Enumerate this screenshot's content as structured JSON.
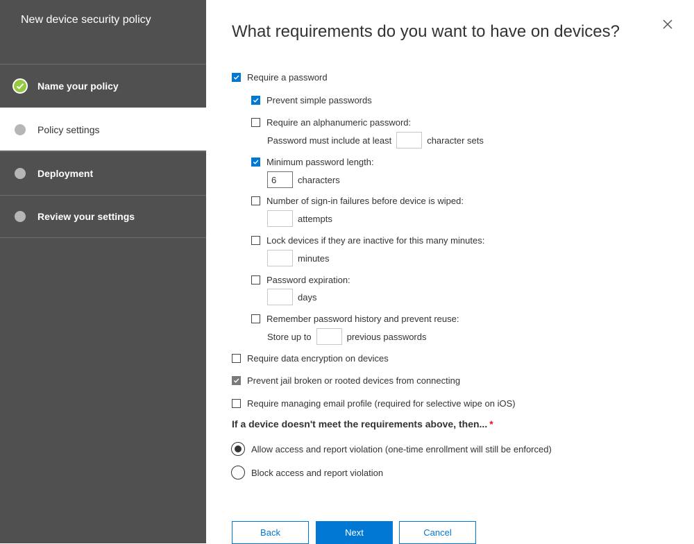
{
  "sidebar": {
    "title": "New device security policy",
    "steps": [
      {
        "label": "Name your policy",
        "state": "completed"
      },
      {
        "label": "Policy settings",
        "state": "active"
      },
      {
        "label": "Deployment",
        "state": "pending"
      },
      {
        "label": "Review your settings",
        "state": "pending"
      }
    ]
  },
  "main": {
    "heading": "What requirements do you want to have on devices?",
    "require_password": {
      "label": "Require a password",
      "checked": true
    },
    "prevent_simple": {
      "label": "Prevent simple passwords",
      "checked": true
    },
    "alphanumeric": {
      "label": "Require an alphanumeric password:",
      "checked": false,
      "prefix": "Password must include at least",
      "value": "",
      "suffix": "character sets"
    },
    "min_length": {
      "label": "Minimum password length:",
      "checked": true,
      "value": "6",
      "suffix": "characters"
    },
    "signin_failures": {
      "label": "Number of sign-in failures before device is wiped:",
      "checked": false,
      "value": "",
      "suffix": "attempts"
    },
    "lock_inactive": {
      "label": "Lock devices if they are inactive for this many minutes:",
      "checked": false,
      "value": "",
      "suffix": "minutes"
    },
    "expiration": {
      "label": "Password expiration:",
      "checked": false,
      "value": "",
      "suffix": "days"
    },
    "history": {
      "label": "Remember password history and prevent reuse:",
      "checked": false,
      "prefix": "Store up to",
      "value": "",
      "suffix": "previous passwords"
    },
    "data_encryption": {
      "label": "Require data encryption on devices",
      "checked": false
    },
    "jailbreak": {
      "label": "Prevent jail broken or rooted devices from connecting",
      "checked": true,
      "disabled": true
    },
    "email_profile": {
      "label": "Require managing email profile (required for selective wipe on iOS)",
      "checked": false
    },
    "violation": {
      "question": "If a device doesn't meet the requirements above, then...",
      "required_mark": "*",
      "options": [
        {
          "label": "Allow access and report violation (one-time enrollment will still be enforced)",
          "selected": true
        },
        {
          "label": "Block access and report violation",
          "selected": false
        }
      ]
    }
  },
  "footer": {
    "back_label": "Back",
    "next_label": "Next",
    "cancel_label": "Cancel"
  },
  "colors": {
    "sidebar_bg": "#505050",
    "accent": "#0078d4",
    "completed": "#95c940",
    "required": "#e81123"
  },
  "icons": {
    "close": "close-icon",
    "check": "checkmark-icon",
    "step_done": "completed-step-icon",
    "step_pending": "step-dot-icon"
  }
}
